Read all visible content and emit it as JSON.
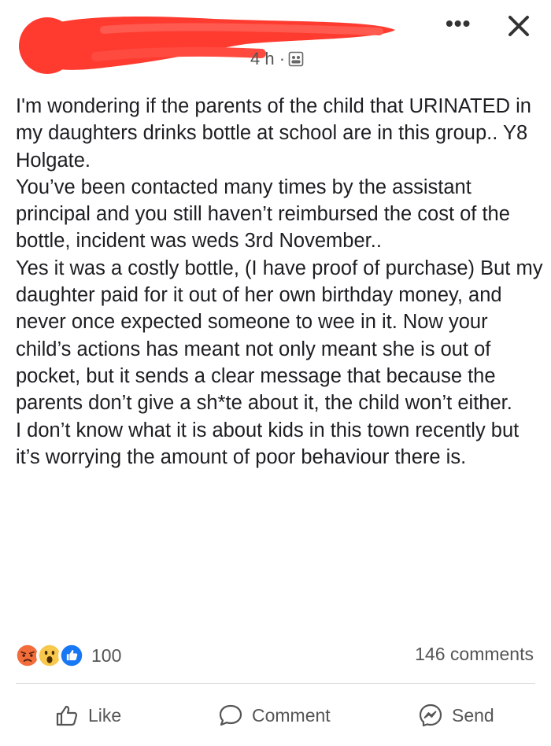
{
  "header": {
    "timestamp": "4 h ·",
    "privacy_icon": "globe-icon",
    "more_label": "•••",
    "redaction_color": "#ff3b30"
  },
  "post": {
    "paragraphs": [
      "I'm wondering if the parents of the child that URINATED in my daughters drinks bottle at school are in this group.. Y8 Holgate.",
      "You’ve been contacted many times by the assistant principal and you still haven’t reimbursed the cost of the bottle, incident was weds 3rd November..",
      "Yes it was a costly bottle, (I have proof of purchase) But my daughter paid for it out of her own birthday money, and never once expected someone to wee in it. Now your child’s actions has meant not only meant she is out of pocket, but it sends a clear message that because the parents don’t give a sh*te about it, the child won’t either.",
      "I don’t know what it is about kids in this town recently but it’s worrying the amount of poor behaviour there is."
    ]
  },
  "engagement": {
    "reactions": [
      "angry",
      "wow",
      "like"
    ],
    "reaction_colors": {
      "angry": "#f36d3a",
      "wow": "#f7c84b",
      "like": "#1877f2"
    },
    "reaction_count": "100",
    "comments_count": "146 comments"
  },
  "actions": {
    "like_label": "Like",
    "comment_label": "Comment",
    "send_label": "Send"
  }
}
